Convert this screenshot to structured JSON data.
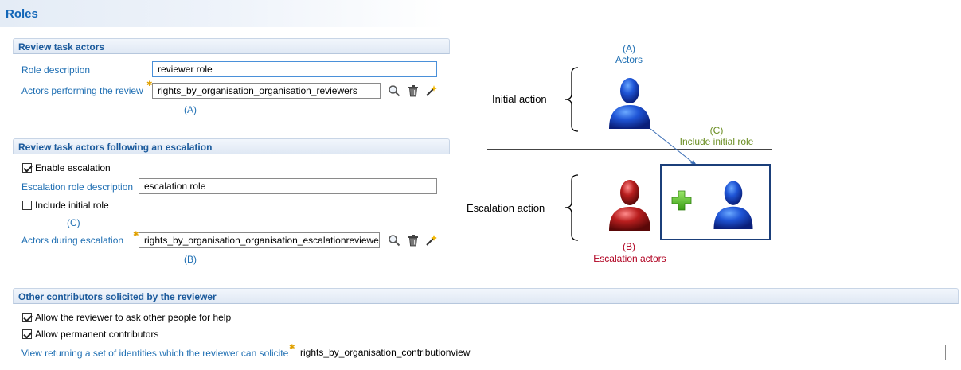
{
  "page": {
    "title": "Roles"
  },
  "review_actors": {
    "header": "Review task actors",
    "role_description_label": "Role description",
    "role_description_value": "reviewer role",
    "actors_label": "Actors performing the review",
    "actors_value": "rights_by_organisation_organisation_reviewers",
    "annotation": "(A)"
  },
  "escalation": {
    "header": "Review task actors following an escalation",
    "enable_label": "Enable escalation",
    "enable_checked": true,
    "role_description_label": "Escalation role description",
    "role_description_value": "escalation role",
    "include_initial_label": "Include initial role",
    "include_initial_checked": false,
    "include_annotation": "(C)",
    "actors_label": "Actors during escalation",
    "actors_value": "rights_by_organisation_organisation_escalationreviewer",
    "actors_annotation": "(B)"
  },
  "contributors": {
    "header": "Other contributors solicited by the reviewer",
    "ask_help_label": "Allow the reviewer to ask other people for help",
    "ask_help_checked": true,
    "permanent_label": "Allow permanent contributors",
    "permanent_checked": true,
    "view_label": "View returning a set of identities which the reviewer can solicite",
    "view_value": "rights_by_organisation_contributionview"
  },
  "diagram": {
    "actors_letter": "(A)",
    "actors_label": "Actors",
    "initial_action": "Initial action",
    "include_letter": "(C)",
    "include_label": "Include initial role",
    "escalation_action": "Escalation action",
    "escalation_letter": "(B)",
    "escalation_label": "Escalation actors",
    "colors": {
      "blue_text": "#1f6fb3",
      "green_text": "#6b8e23",
      "red_text": "#b00020",
      "box_border": "#1b3f7a"
    }
  },
  "icons": [
    "search-icon",
    "delete-icon",
    "wand-icon",
    "required-icon",
    "actor-blue-icon",
    "actor-red-icon",
    "plus-icon"
  ]
}
